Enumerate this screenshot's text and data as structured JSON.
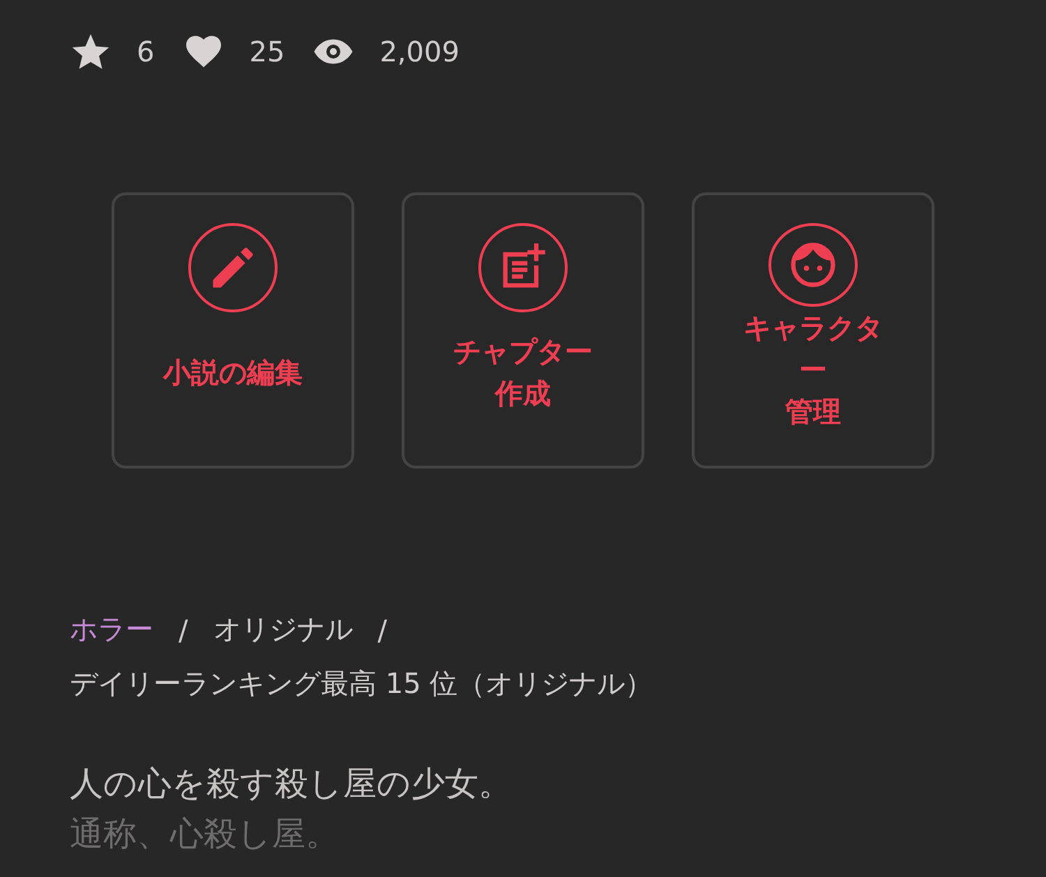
{
  "stats": [
    {
      "kind": "star",
      "value": "6"
    },
    {
      "kind": "heart",
      "value": "25"
    },
    {
      "kind": "views",
      "value": "2,009"
    }
  ],
  "actions": [
    {
      "kind": "edit",
      "lines": [
        "小説の編集"
      ]
    },
    {
      "kind": "chapter",
      "lines": [
        "チャプター",
        "作成"
      ]
    },
    {
      "kind": "character",
      "lines": [
        "キャラクタ",
        "ー",
        "管理"
      ]
    }
  ],
  "tags": [
    {
      "kind": "genre",
      "label": "ホラー",
      "separator": "/"
    },
    {
      "kind": "tag",
      "label": "オリジナル",
      "separator": "/"
    }
  ],
  "ranking": "デイリーランキング最高 15 位（オリジナル）",
  "description": [
    "人の心を殺す殺し屋の少女。",
    "通称、心殺し屋。"
  ]
}
